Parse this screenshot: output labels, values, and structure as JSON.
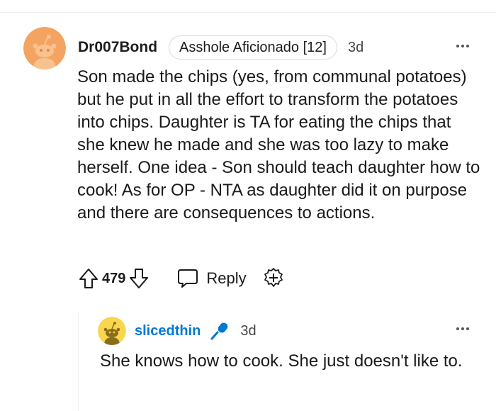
{
  "comment": {
    "username": "Dr007Bond",
    "flair": "Asshole Aficionado [12]",
    "timestamp": "3d",
    "body": "Son made the chips (yes, from communal potatoes) but he put in all the effort to transform the potatoes into chips. Daughter is TA for eating the chips that she knew he made and she was too lazy to make herself. One idea - Son should teach daughter how to cook! As for OP - NTA as daughter did it on purpose and there are consequences to actions.",
    "vote_count": "479",
    "reply_label": "Reply",
    "avatar_color": "#f4a460"
  },
  "reply": {
    "username": "slicedthin",
    "timestamp": "3d",
    "body": "She knows how to cook. She just doesn't like to.",
    "avatar_color": "#f8d64e",
    "username_color": "#0079d3"
  },
  "icons": [
    "upvote-icon",
    "downvote-icon",
    "reply-bubble-icon",
    "award-icon",
    "more-options-icon",
    "microphone-icon",
    "snoo-avatar-icon"
  ]
}
